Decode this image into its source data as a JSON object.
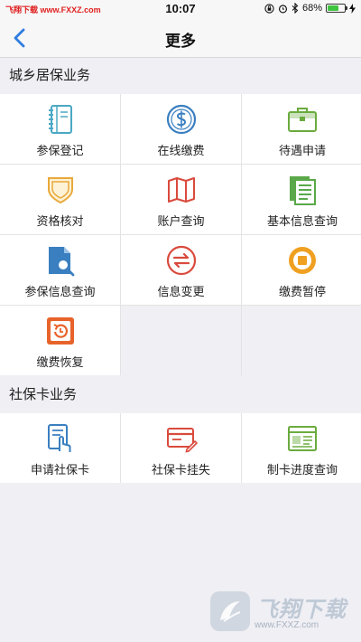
{
  "status_bar": {
    "carrier": "飞翔下载 www.FXXZ.com",
    "time": "10:07",
    "battery": "68%",
    "battery_level": 0.68
  },
  "nav": {
    "title": "更多",
    "back_icon": "chevron-left-icon"
  },
  "sections": [
    {
      "title": "城乡居保业务",
      "items": [
        {
          "label": "参保登记",
          "icon": "notebook-icon",
          "color": "#4aa8c4"
        },
        {
          "label": "在线缴费",
          "icon": "dollar-coin-icon",
          "color": "#3a7fc0"
        },
        {
          "label": "待遇申请",
          "icon": "briefcase-icon",
          "color": "#6aab3e"
        },
        {
          "label": "资格核对",
          "icon": "shield-icon",
          "color": "#e8a93a"
        },
        {
          "label": "账户查询",
          "icon": "map-icon",
          "color": "#d94a3c"
        },
        {
          "label": "基本信息查询",
          "icon": "documents-icon",
          "color": "#5aa84a"
        },
        {
          "label": "参保信息查询",
          "icon": "file-search-icon",
          "color": "#3a7fc0"
        },
        {
          "label": "信息变更",
          "icon": "swap-icon",
          "color": "#d94a3c"
        },
        {
          "label": "缴费暂停",
          "icon": "pause-circle-icon",
          "color": "#f0a020"
        },
        {
          "label": "缴费恢复",
          "icon": "restore-icon",
          "color": "#e8632a"
        }
      ]
    },
    {
      "title": "社保卡业务",
      "items": [
        {
          "label": "申请社保卡",
          "icon": "card-touch-icon",
          "color": "#3a7fc0"
        },
        {
          "label": "社保卡挂失",
          "icon": "card-edit-icon",
          "color": "#d94a3c"
        },
        {
          "label": "制卡进度查询",
          "icon": "browser-window-icon",
          "color": "#6aab3e"
        }
      ]
    }
  ],
  "watermark": {
    "title": "飞翔下载",
    "url": "www.FXXZ.com"
  }
}
